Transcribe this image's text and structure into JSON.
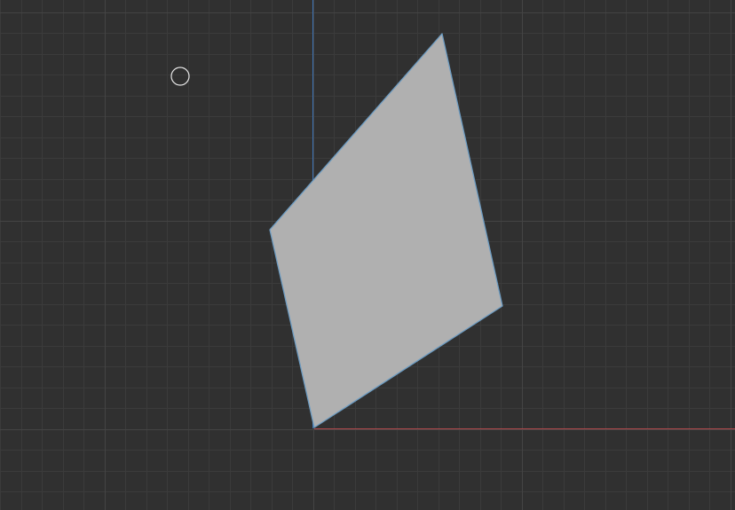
{
  "viewport": {
    "view": "top-orthographic",
    "background_color": "#303030",
    "grid": {
      "visible": true,
      "minor_color": "#3b3b3b",
      "major_color": "#444444"
    },
    "axes": {
      "x_axis_color": "#b54a4d",
      "y_axis_color": "#3d73b5"
    },
    "mesh": {
      "object_type": "plane",
      "face_count": 1,
      "face_color": "#b0b0b0",
      "edge_color": "#6d9cc2",
      "selected": true
    },
    "cursor": {
      "icon": "3d-cursor-icon",
      "color": "#e6e6e6"
    }
  }
}
